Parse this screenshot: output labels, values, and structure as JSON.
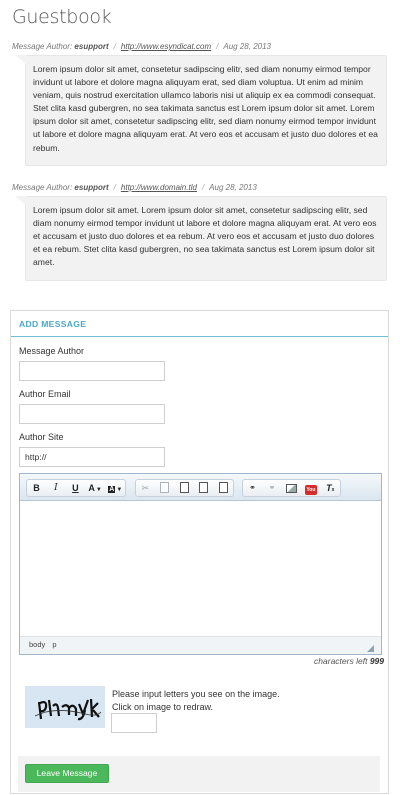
{
  "page": {
    "title": "Guestbook"
  },
  "entries": [
    {
      "author_prefix": "Message Author:",
      "author": "esupport",
      "site": "http://www.esyndicat.com",
      "date": "Aug 28, 2013",
      "text": "Lorem ipsum dolor sit amet, consetetur sadipscing elitr, sed diam nonumy eirmod tempor invidunt ut labore et dolore magna aliquyam erat, sed diam voluptua. Ut enim ad minim veniam, quis nostrud exercitation ullamco laboris nisi ut aliquip ex ea commodi consequat. Stet clita kasd gubergren, no sea takimata sanctus est Lorem ipsum dolor sit amet. Lorem ipsum dolor sit amet, consetetur sadipscing elitr, sed diam nonumy eirmod tempor invidunt ut labore et dolore magna aliquyam erat. At vero eos et accusam et justo duo dolores et ea rebum."
    },
    {
      "author_prefix": "Message Author:",
      "author": "esupport",
      "site": "http://www.domain.tld",
      "date": "Aug 28, 2013",
      "text": "Lorem ipsum dolor sit amet. Lorem ipsum dolor sit amet, consetetur sadipscing elitr, sed diam nonumy eirmod tempor invidunt ut labore et dolore magna aliquyam erat. At vero eos et accusam et justo duo dolores et ea rebum. At vero eos et accusam et justo duo dolores et ea rebum. Stet clita kasd gubergren, no sea takimata sanctus est Lorem ipsum dolor sit amet."
    }
  ],
  "form": {
    "heading": "ADD MESSAGE",
    "author_label": "Message Author",
    "author_value": "",
    "email_label": "Author Email",
    "email_value": "",
    "site_label": "Author Site",
    "site_value": "http://",
    "editor": {
      "toolbar": {
        "bold": "B",
        "italic": "I",
        "underline": "U",
        "text_color": "A",
        "bg_color": "A",
        "clear_format": "T"
      },
      "status_path": [
        "body",
        "p"
      ]
    },
    "chars_left_label": "characters left",
    "chars_left_value": "999",
    "captcha_line1": "Please input letters you see on the image.",
    "captcha_line2": "Click on image to redraw.",
    "captcha_value": "",
    "submit_label": "Leave Message"
  },
  "colors": {
    "accent": "#4aa8c4",
    "submit": "#4cb85c",
    "bubble_bg": "#f2f2f2"
  }
}
